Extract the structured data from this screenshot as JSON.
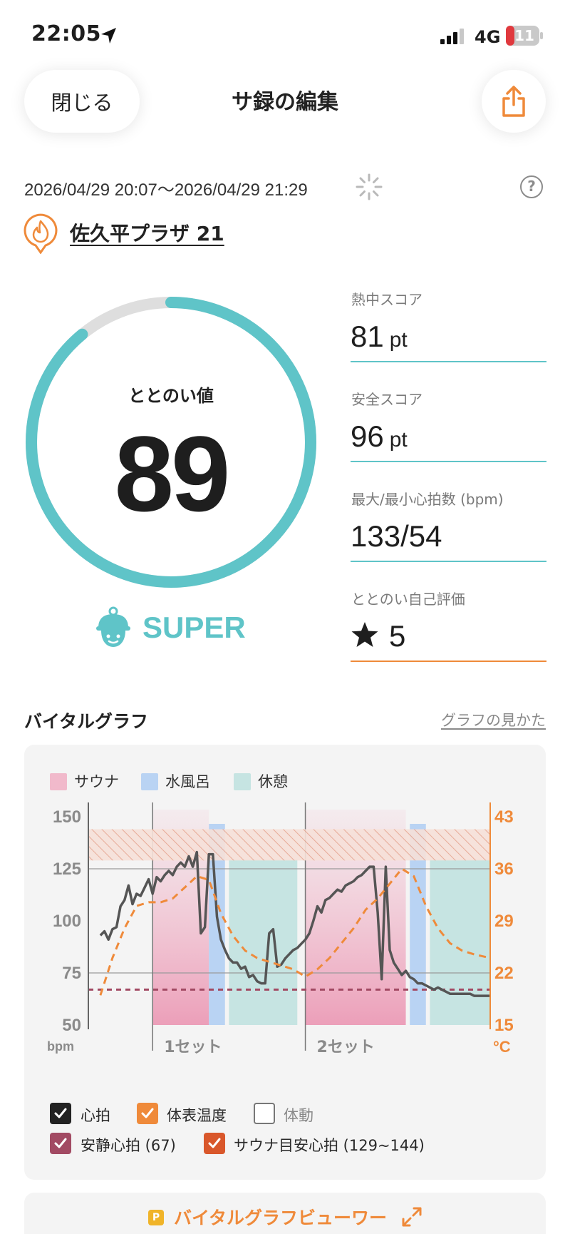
{
  "status_bar": {
    "time": "22:05",
    "network": "4G",
    "battery": "11"
  },
  "nav": {
    "close_label": "閉じる",
    "title": "サ録の編集"
  },
  "session": {
    "datetime": "2026/04/29 20:07～2026/04/29 21:29",
    "facility_name": "佐久平プラザ 21"
  },
  "score": {
    "label": "ととのい値",
    "value": "89",
    "ring_fraction": 0.89,
    "grade": "SUPER"
  },
  "metrics": [
    {
      "label": "熱中スコア",
      "value": "81",
      "unit": "pt"
    },
    {
      "label": "安全スコア",
      "value": "96",
      "unit": "pt"
    },
    {
      "label": "最大/最小心拍数 (bpm)",
      "value": "133/54",
      "unit": ""
    },
    {
      "label": "ととのい自己評価",
      "value": "5",
      "unit": ""
    }
  ],
  "vital_graph": {
    "title": "バイタルグラフ",
    "help_link": "グラフの見かた",
    "legend": [
      "サウナ",
      "水風呂",
      "休憩"
    ],
    "y_left_unit": "bpm",
    "y_right_unit": "°C",
    "set_labels": [
      "1セット",
      "2セット"
    ],
    "checkboxes": [
      {
        "label": "心拍",
        "checked": true,
        "color": "#222222"
      },
      {
        "label": "体表温度",
        "checked": true,
        "color": "#ef8a3a"
      },
      {
        "label": "体動",
        "checked": false,
        "color": "#777777"
      },
      {
        "label": "安静心拍 (67)",
        "checked": true,
        "color": "#a24a63"
      },
      {
        "label": "サウナ目安心拍 (129~144)",
        "checked": true,
        "color": "#d9572b"
      }
    ]
  },
  "chart_data": {
    "type": "line",
    "x_range": [
      0,
      100
    ],
    "y_left_ticks": [
      150,
      125,
      100,
      75,
      50
    ],
    "y_right_ticks": [
      43,
      36,
      29,
      22,
      15
    ],
    "ylim_left": [
      50,
      150
    ],
    "ylim_right": [
      15,
      43
    ],
    "resting_hr": 67,
    "target_hr_range": [
      129,
      144
    ],
    "sets": [
      {
        "label": "1セット",
        "sauna": [
          16,
          30
        ],
        "cold": [
          30,
          34
        ],
        "rest": [
          35,
          52
        ]
      },
      {
        "label": "2セット",
        "sauna": [
          54,
          79
        ],
        "cold": [
          80,
          84
        ],
        "rest": [
          85,
          100
        ]
      }
    ],
    "series": [
      {
        "name": "心拍",
        "axis": "left",
        "color": "#555555",
        "x": [
          3,
          4,
          5,
          6,
          7,
          8,
          9,
          10,
          11,
          12,
          13,
          14,
          15,
          16,
          17,
          18,
          19,
          20,
          21,
          22,
          23,
          24,
          25,
          26,
          27,
          28,
          29,
          30,
          31,
          32,
          33,
          34,
          35,
          36,
          37,
          38,
          39,
          40,
          41,
          42,
          43,
          44,
          45,
          46,
          47,
          48,
          49,
          50,
          51,
          52,
          53,
          54,
          55,
          56,
          57,
          58,
          59,
          60,
          61,
          62,
          63,
          64,
          65,
          66,
          67,
          68,
          69,
          70,
          71,
          72,
          73,
          74,
          75,
          76,
          77,
          78,
          79,
          80,
          81,
          82,
          83,
          84,
          85,
          86,
          87,
          88,
          89,
          90,
          91,
          92,
          93,
          94,
          95,
          96,
          97,
          98,
          99,
          100
        ],
        "y": [
          93,
          95,
          91,
          96,
          97,
          107,
          110,
          117,
          108,
          113,
          112,
          116,
          120,
          113,
          121,
          119,
          122,
          124,
          122,
          126,
          128,
          126,
          131,
          126,
          133,
          94,
          97,
          132,
          132,
          102,
          91,
          86,
          82,
          80,
          80,
          77,
          78,
          73,
          74,
          71,
          70,
          70,
          94,
          96,
          78,
          79,
          82,
          84,
          86,
          87,
          89,
          91,
          94,
          100,
          107,
          104,
          110,
          111,
          113,
          115,
          114,
          117,
          118,
          119,
          121,
          122,
          124,
          126,
          126,
          104,
          72,
          126,
          86,
          80,
          77,
          74,
          76,
          73,
          72,
          70,
          70,
          69,
          68,
          67,
          68,
          67,
          66,
          65,
          65,
          65,
          65,
          65,
          65,
          64,
          64,
          64,
          64,
          64
        ]
      },
      {
        "name": "体表温度",
        "axis": "right",
        "color": "#ef8a3a",
        "x": [
          3,
          6,
          9,
          12,
          15,
          18,
          21,
          24,
          27,
          30,
          33,
          36,
          39,
          42,
          45,
          48,
          51,
          54,
          57,
          60,
          63,
          66,
          69,
          72,
          75,
          78,
          81,
          84,
          87,
          90,
          93,
          96,
          100
        ],
        "y": [
          19,
          24,
          28,
          31,
          31.5,
          31.5,
          32,
          33.5,
          35,
          34.5,
          30,
          27,
          25,
          24,
          23.5,
          23,
          22.5,
          21.5,
          22.5,
          24,
          26,
          28,
          30.5,
          32,
          34,
          36,
          35,
          31,
          28,
          26,
          25,
          24.5,
          24
        ]
      }
    ]
  }
}
